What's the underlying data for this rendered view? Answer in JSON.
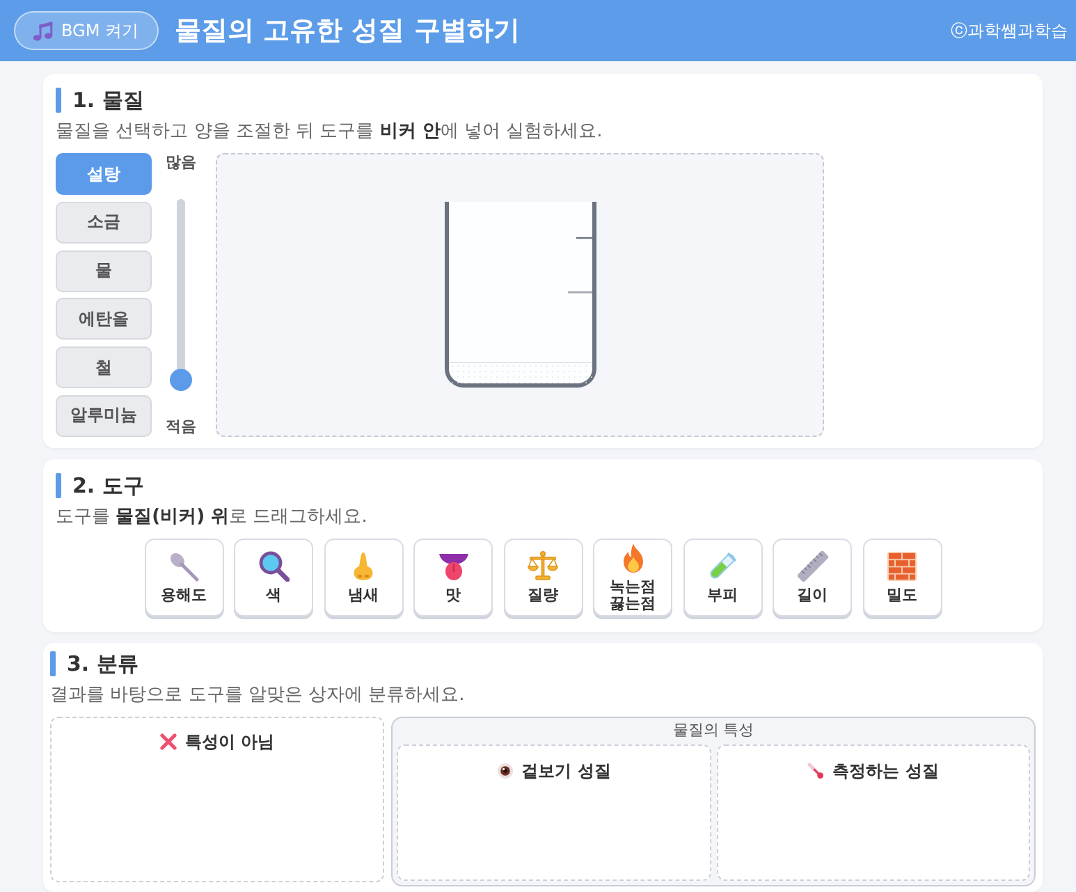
{
  "header": {
    "bgm_button": "BGM 켜기",
    "title": "물질의 고유한 성질 구별하기",
    "copyright": "ⓒ과학쌤과학습"
  },
  "material_section": {
    "heading": "1. 물질",
    "instruction": "물질을 선택하고 양을 조절한 뒤 도구를 **비커 안**에 넣어 실험하세요.",
    "materials": [
      {
        "label": "설탕",
        "selected": true
      },
      {
        "label": "소금",
        "selected": false
      },
      {
        "label": "물",
        "selected": false
      },
      {
        "label": "에탄올",
        "selected": false
      },
      {
        "label": "철",
        "selected": false
      },
      {
        "label": "알루미늄",
        "selected": false
      }
    ],
    "amount_slider": {
      "max_label": "많음",
      "min_label": "적음",
      "level": 0
    }
  },
  "tool_section": {
    "heading": "2. 도구",
    "instruction": "도구를 **물질(비커) 위**로 드래그하세요.",
    "tools": [
      {
        "label": "용해도"
      },
      {
        "label": "색"
      },
      {
        "label": "냄새"
      },
      {
        "label": "맛"
      },
      {
        "label": "질량"
      },
      {
        "label": "녹는점 끓는점"
      },
      {
        "label": "부피"
      },
      {
        "label": "길이"
      },
      {
        "label": "밀도"
      }
    ]
  },
  "sorting_section": {
    "heading": "3. 분류",
    "instruction": "결과를 바탕으로 도구를 알맞은 상자에 분류하세요.",
    "not_property_box": {
      "label": "특성이 아님"
    },
    "property_group": {
      "label": "물질의 특성",
      "boxes": [
        {
          "label": "겉보기 성질"
        },
        {
          "label": "측정하는 성질"
        }
      ]
    }
  }
}
